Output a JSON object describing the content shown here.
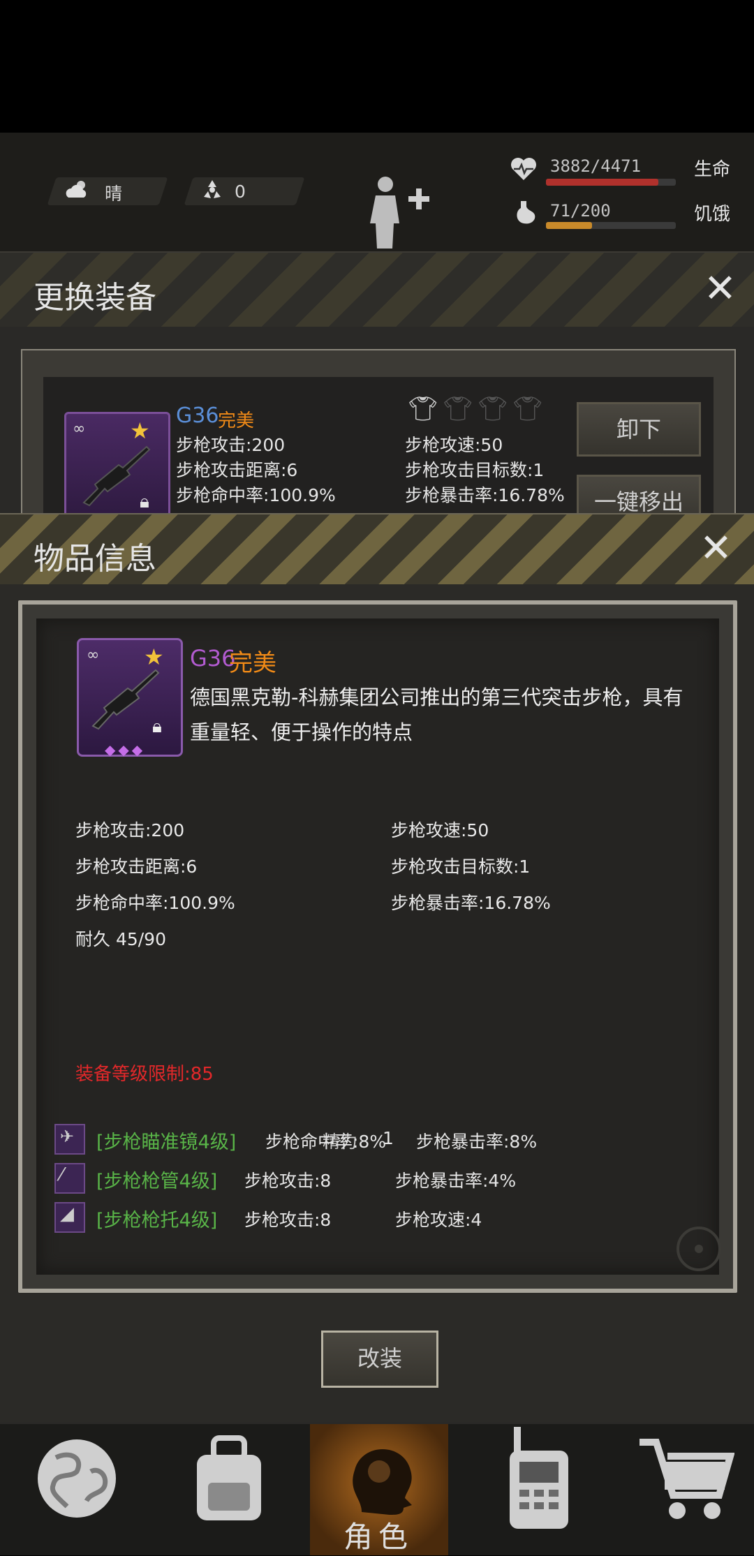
{
  "hud": {
    "weather": "晴",
    "radiation": "0",
    "life_value": "3882/4471",
    "life_label": "生命",
    "hunger_value": "71/200",
    "hunger_label": "饥饿",
    "life_fraction": 0.868,
    "hunger_fraction": 0.355
  },
  "equip_panel": {
    "title": "更换装备",
    "item_name": "G36",
    "item_quality": "完美",
    "stats_left": [
      "步枪攻击:200",
      "步枪攻击距离:6",
      "步枪命中率:100.9%"
    ],
    "stats_right": [
      "步枪攻速:50",
      "步枪攻击目标数:1",
      "步枪暴击率:16.78%"
    ],
    "unequip_button": "卸下",
    "move_out_button": "一键移出"
  },
  "item_info": {
    "title": "物品信息",
    "item_name": "G36",
    "item_quality": "完美",
    "description_line1": "德国黑克勒-科赫集团公司推出的第三代突击步枪，具有",
    "description_line2": "重量轻、便于操作的特点",
    "stats_left": [
      "步枪攻击:200",
      "步枪攻击距离:6",
      "步枪命中率:100.9%"
    ],
    "stats_right": [
      "步枪攻速:50",
      "步枪攻击目标数:1",
      "步枪暴击率:16.78%"
    ],
    "durability": "耐久 45/90",
    "level_requirement": "装备等级限制:85",
    "attachments": [
      {
        "name": "[步枪瞄准镜4级]",
        "stat1": "步枪命中率:8%",
        "stat2": "步枪暴击率:8%",
        "overlay": "精力",
        "overlay2": "1"
      },
      {
        "name": "[步枪枪管4级]",
        "stat1": "步枪攻击:8",
        "stat2": "步枪暴击率:4%"
      },
      {
        "name": "[步枪枪托4级]",
        "stat1": "步枪攻击:8",
        "stat2": "步枪攻速:4"
      }
    ],
    "modify_button": "改装"
  },
  "nav": {
    "items": [
      "world",
      "backpack",
      "角色",
      "radio",
      "shop"
    ],
    "active_label": "角色"
  },
  "colors": {
    "item_name_blue": "#5b8fd8",
    "item_name_purple": "#b25bd0",
    "quality_orange": "#f08a17",
    "level_red": "#e3282a",
    "attachment_green": "#59b548"
  }
}
